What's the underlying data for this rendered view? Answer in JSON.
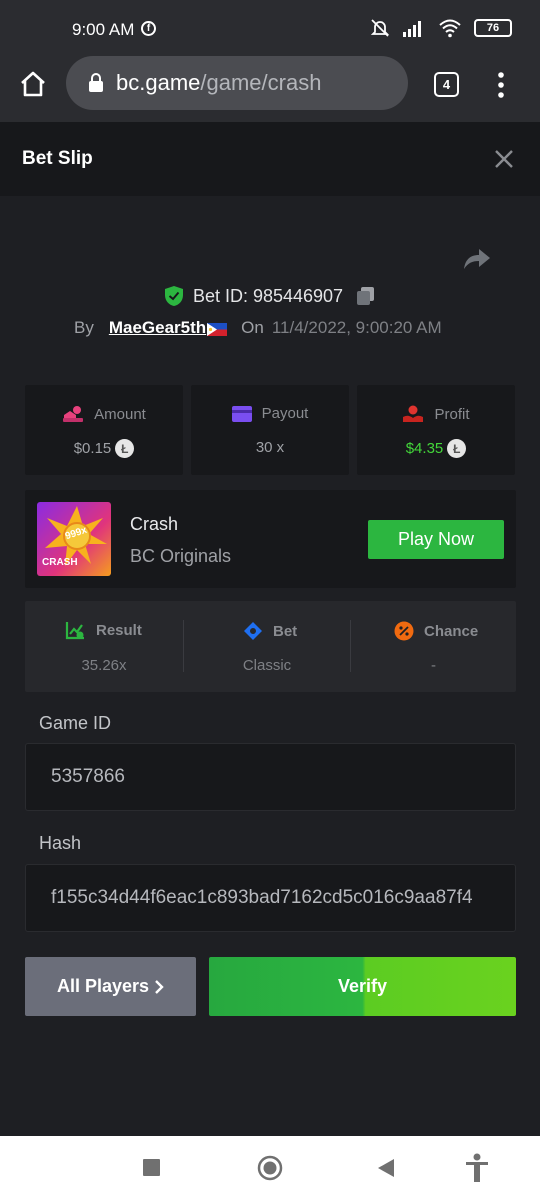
{
  "status": {
    "time": "9:00 AM",
    "battery": "76"
  },
  "browser": {
    "url_host": "bc.game",
    "url_path": "/game/crash",
    "tab_count": "4"
  },
  "header": {
    "title": "Bet Slip"
  },
  "bet": {
    "bet_id": "Bet ID: 985446907",
    "by_label": "By",
    "user": "MaeGear5th",
    "on_label": "On",
    "timestamp": "11/4/2022, 9:00:20 AM"
  },
  "stats": {
    "amount_label": "Amount",
    "amount_value": "$0.15",
    "payout_label": "Payout",
    "payout_value": "30 x",
    "profit_label": "Profit",
    "profit_value": "$4.35"
  },
  "game": {
    "name": "Crash",
    "provider": "BC Originals",
    "thumb_badge": "999x",
    "thumb_label": "CRASH",
    "play_button": "Play Now"
  },
  "result": {
    "result_label": "Result",
    "result_value": "35.26x",
    "bet_label": "Bet",
    "bet_value": "Classic",
    "chance_label": "Chance",
    "chance_value": "-"
  },
  "fields": {
    "game_id_label": "Game ID",
    "game_id_value": "5357866",
    "hash_label": "Hash",
    "hash_value": "f155c34d44f6eac1c893bad7162cd5c016c9aa87f4"
  },
  "actions": {
    "all_players": "All Players",
    "verify": "Verify"
  },
  "colors": {
    "green": "#2cb640",
    "profit": "#43d63a",
    "accent_purple": "#6b4bd8"
  }
}
